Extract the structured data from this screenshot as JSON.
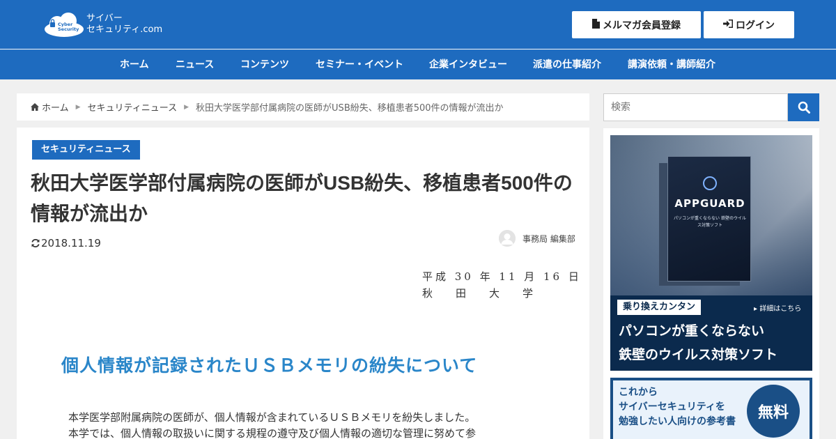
{
  "header": {
    "logo": {
      "line1": "サイバー",
      "line2": "セキュリティ.com",
      "badge": "Cyber Security"
    },
    "newsletter_button": "メルマガ会員登録",
    "login_button": "ログイン"
  },
  "nav": {
    "items": [
      "ホーム",
      "ニュース",
      "コンテンツ",
      "セミナー・イベント",
      "企業インタビュー",
      "派遣の仕事紹介",
      "講演依頼・講師紹介"
    ]
  },
  "breadcrumb": {
    "home": "ホーム",
    "section": "セキュリティニュース",
    "current": "秋田大学医学部付属病院の医師がUSB紛失、移植患者500件の情報が流出か"
  },
  "article": {
    "category": "セキュリティニュース",
    "title": "秋田大学医学部付属病院の医師がUSB紛失、移植患者500件の情報が流出か",
    "date": "2018.11.19",
    "author": "事務局 編集部",
    "document": {
      "date": "平成 30 年 11 月 16 日",
      "org": "秋田大学",
      "heading": "個人情報が記録されたＵＳＢメモリの紛失について",
      "line1": "本学医学部附属病院の医師が、個人情報が含まれているＵＳＢメモリを紛失しました。",
      "line2": "本学では、個人情報の取扱いに関する規程の遵守及び個人情報の適切な管理に努めて参"
    }
  },
  "sidebar": {
    "search_placeholder": "検索",
    "ad1": {
      "box_label": "APPGUARD",
      "box_sub": "パソコンが重くならない 鉄壁のウイルス対策ソフト",
      "tag": "乗り換えカンタン",
      "details": "▸ 詳細はこちら",
      "line1": "パソコンが重くならない",
      "line2": "鉄壁のウイルス対策ソフト"
    },
    "ad2": {
      "line1": "これから",
      "line2": "サイバーセキュリティを",
      "line3": "勉強したい人向けの参考書",
      "badge": "無料"
    }
  },
  "colors": {
    "brand": "#1e6bbf",
    "doc_heading": "#2a86c9"
  }
}
